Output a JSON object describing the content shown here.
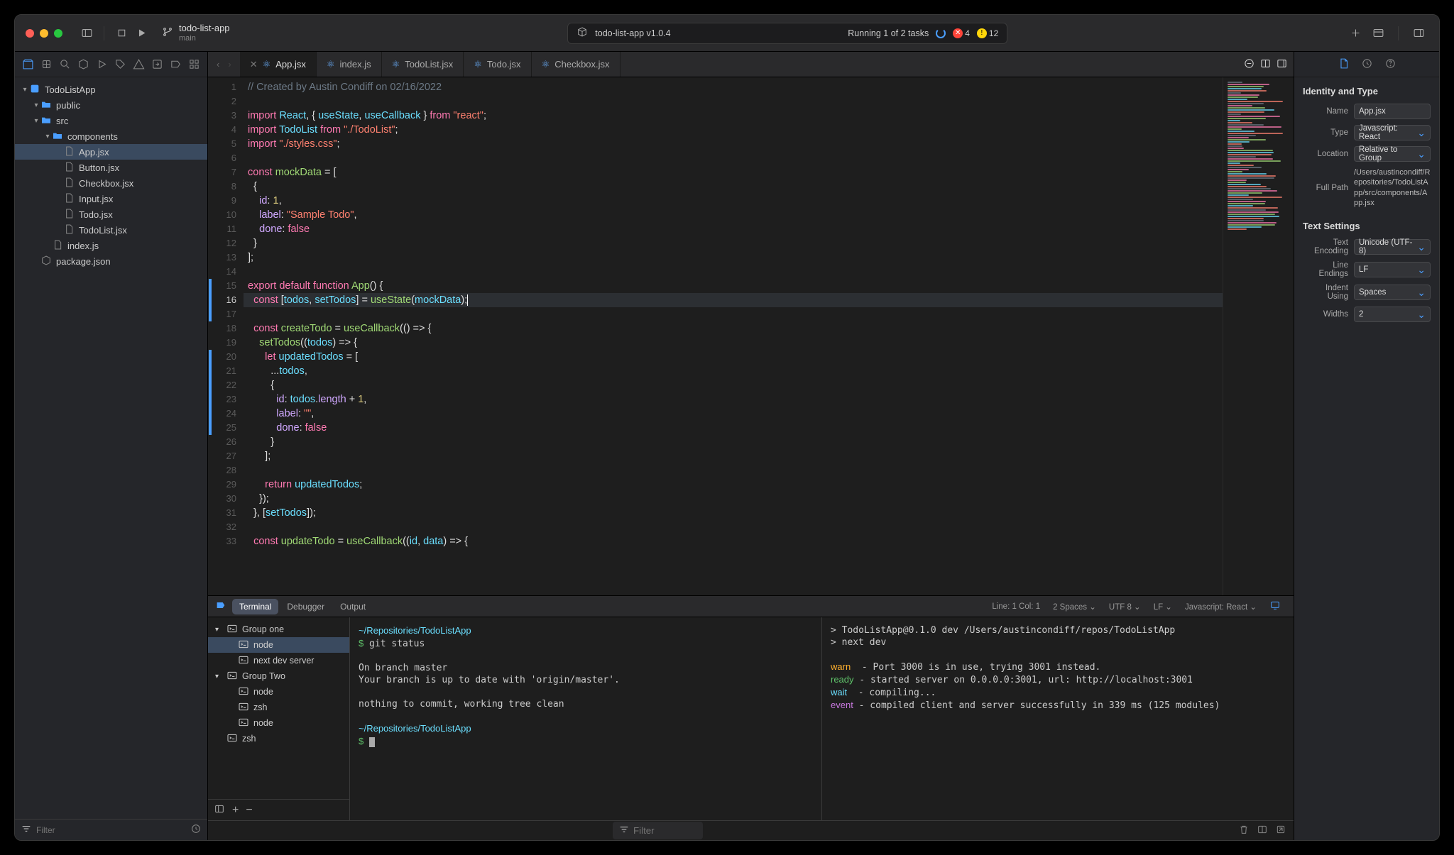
{
  "titlebar": {
    "project_name": "todo-list-app",
    "branch": "main",
    "status_text": "todo-list-app v1.0.4",
    "tasks_text": "Running 1 of 2 tasks",
    "errors": "4",
    "warnings": "12"
  },
  "sidebar": {
    "filter_placeholder": "Filter",
    "tree": [
      {
        "depth": 0,
        "type": "root",
        "icon": "app",
        "label": "TodoListApp",
        "expanded": true
      },
      {
        "depth": 1,
        "type": "folder",
        "icon": "folder",
        "label": "public",
        "expanded": true
      },
      {
        "depth": 1,
        "type": "folder",
        "icon": "folder",
        "label": "src",
        "expanded": true
      },
      {
        "depth": 2,
        "type": "folder",
        "icon": "folder",
        "label": "components",
        "expanded": true
      },
      {
        "depth": 3,
        "type": "file",
        "icon": "file",
        "label": "App.jsx",
        "selected": true
      },
      {
        "depth": 3,
        "type": "file",
        "icon": "file",
        "label": "Button.jsx"
      },
      {
        "depth": 3,
        "type": "file",
        "icon": "file",
        "label": "Checkbox.jsx"
      },
      {
        "depth": 3,
        "type": "file",
        "icon": "file",
        "label": "Input.jsx"
      },
      {
        "depth": 3,
        "type": "file",
        "icon": "file",
        "label": "Todo.jsx"
      },
      {
        "depth": 3,
        "type": "file",
        "icon": "file",
        "label": "TodoList.jsx"
      },
      {
        "depth": 2,
        "type": "file",
        "icon": "file",
        "label": "index.js"
      },
      {
        "depth": 1,
        "type": "file",
        "icon": "pkg",
        "label": "package.json"
      }
    ]
  },
  "tabs": [
    {
      "label": "App.jsx",
      "icon": "react",
      "active": true,
      "close": true
    },
    {
      "label": "index.js",
      "icon": "react",
      "active": false,
      "close": false
    },
    {
      "label": "TodoList.jsx",
      "icon": "react",
      "active": false,
      "close": false
    },
    {
      "label": "Todo.jsx",
      "icon": "react",
      "active": false,
      "close": false
    },
    {
      "label": "Checkbox.jsx",
      "icon": "react",
      "active": false,
      "close": false
    }
  ],
  "editor": {
    "change_bars": [
      {
        "from": 15,
        "to": 17
      },
      {
        "from": 20,
        "to": 25
      }
    ],
    "highlight_line": 16,
    "lines": [
      {
        "n": 1,
        "html": "<span class='c-comment'>// Created by Austin Condiff on 02/16/2022</span>"
      },
      {
        "n": 2,
        "html": ""
      },
      {
        "n": 3,
        "html": "<span class='c-kw'>import</span> <span class='c-var'>React</span>, { <span class='c-var'>useState</span>, <span class='c-var'>useCallback</span> } <span class='c-kw'>from</span> <span class='c-str'>\"react\"</span>;"
      },
      {
        "n": 4,
        "html": "<span class='c-kw'>import</span> <span class='c-var'>TodoList</span> <span class='c-kw'>from</span> <span class='c-str'>\"./TodoList\"</span>;"
      },
      {
        "n": 5,
        "html": "<span class='c-kw'>import</span> <span class='c-str'>\"./styles.css\"</span>;"
      },
      {
        "n": 6,
        "html": ""
      },
      {
        "n": 7,
        "html": "<span class='c-kw'>const</span> <span class='c-fn'>mockData</span> = ["
      },
      {
        "n": 8,
        "html": "  {"
      },
      {
        "n": 9,
        "html": "    <span class='c-prop'>id</span>: <span class='c-num'>1</span>,"
      },
      {
        "n": 10,
        "html": "    <span class='c-prop'>label</span>: <span class='c-str'>\"Sample Todo\"</span>,"
      },
      {
        "n": 11,
        "html": "    <span class='c-prop'>done</span>: <span class='c-kw'>false</span>"
      },
      {
        "n": 12,
        "html": "  }"
      },
      {
        "n": 13,
        "html": "];"
      },
      {
        "n": 14,
        "html": ""
      },
      {
        "n": 15,
        "html": "<span class='c-kw'>export</span> <span class='c-kw'>default</span> <span class='c-kw'>function</span> <span class='c-fn'>App</span>() {"
      },
      {
        "n": 16,
        "html": "  <span class='c-kw'>const</span> [<span class='c-var'>todos</span>, <span class='c-var'>setTodos</span>] = <span class='c-fn'>useState</span>(<span class='c-var'>mockData</span>);<span class='cursor'></span>"
      },
      {
        "n": 17,
        "html": ""
      },
      {
        "n": 18,
        "html": "  <span class='c-kw'>const</span> <span class='c-fn'>createTodo</span> = <span class='c-fn'>useCallback</span>(() =&gt; {"
      },
      {
        "n": 19,
        "html": "    <span class='c-fn'>setTodos</span>((<span class='c-var'>todos</span>) =&gt; {"
      },
      {
        "n": 20,
        "html": "      <span class='c-kw'>let</span> <span class='c-var'>updatedTodos</span> = ["
      },
      {
        "n": 21,
        "html": "        ...<span class='c-var'>todos</span>,"
      },
      {
        "n": 22,
        "html": "        {"
      },
      {
        "n": 23,
        "html": "          <span class='c-prop'>id</span>: <span class='c-var'>todos</span>.<span class='c-prop'>length</span> + <span class='c-num'>1</span>,"
      },
      {
        "n": 24,
        "html": "          <span class='c-prop'>label</span>: <span class='c-str'>\"\"</span>,"
      },
      {
        "n": 25,
        "html": "          <span class='c-prop'>done</span>: <span class='c-kw'>false</span>"
      },
      {
        "n": 26,
        "html": "        }"
      },
      {
        "n": 27,
        "html": "      ];"
      },
      {
        "n": 28,
        "html": ""
      },
      {
        "n": 29,
        "html": "      <span class='c-kw'>return</span> <span class='c-var'>updatedTodos</span>;"
      },
      {
        "n": 30,
        "html": "    });"
      },
      {
        "n": 31,
        "html": "  }, [<span class='c-var'>setTodos</span>]);"
      },
      {
        "n": 32,
        "html": ""
      },
      {
        "n": 33,
        "html": "  <span class='c-kw'>const</span> <span class='c-fn'>updateTodo</span> = <span class='c-fn'>useCallback</span>((<span class='c-var'>id</span>, <span class='c-var'>data</span>) =&gt; {"
      }
    ]
  },
  "bottom": {
    "tabs": [
      "Terminal",
      "Debugger",
      "Output"
    ],
    "active_tab": 0,
    "status": {
      "line_col": "Line: 1  Col: 1",
      "spaces": "2 Spaces",
      "encoding": "UTF 8",
      "eol": "LF",
      "lang": "Javascript: React"
    },
    "term_groups": [
      {
        "label": "Group one",
        "expanded": true,
        "items": [
          {
            "label": "node",
            "selected": true
          },
          {
            "label": "next dev server"
          }
        ]
      },
      {
        "label": "Group Two",
        "expanded": true,
        "items": [
          {
            "label": "node"
          },
          {
            "label": "zsh"
          },
          {
            "label": "node"
          }
        ]
      },
      {
        "label": "zsh",
        "leaf": true
      }
    ],
    "pane1_html": "<span class='t-path'>~/Repositories/TodoListApp</span>\n<span class='t-prompt'>$</span> git status\n\nOn branch master\nYour branch is up to date with 'origin/master'.\n\nnothing to commit, working tree clean\n\n<span class='t-path'>~/Repositories/TodoListApp</span>\n<span class='t-prompt'>$</span> <span class='t-cursor'></span>",
    "pane2_html": "&gt; TodoListApp@0.1.0 dev /Users/austincondiff/repos/TodoListApp\n&gt; next dev\n\n<span class='t-warn'>warn</span>  - Port 3000 is in use, trying 3001 instead.\n<span class='t-ready'>ready</span> - started server on 0.0.0.0:3001, url: http://localhost:3001\n<span class='t-wait'>wait</span>  - compiling...\n<span class='t-event'>event</span> - compiled client and server successfully in 339 ms (125 modules)",
    "filter_placeholder": "Filter"
  },
  "inspector": {
    "identity_heading": "Identity and Type",
    "settings_heading": "Text Settings",
    "name_label": "Name",
    "name_value": "App.jsx",
    "type_label": "Type",
    "type_value": "Javascript: React",
    "location_label": "Location",
    "location_value": "Relative to Group",
    "fullpath_label": "Full Path",
    "fullpath_value": "/Users/austincondiff/Repositories/TodoListApp/src/components/App.jsx",
    "encoding_label": "Text Encoding",
    "encoding_value": "Unicode (UTF-8)",
    "eol_label": "Line Endings",
    "eol_value": "LF",
    "indent_label": "Indent Using",
    "indent_value": "Spaces",
    "widths_label": "Widths",
    "widths_value": "2"
  }
}
